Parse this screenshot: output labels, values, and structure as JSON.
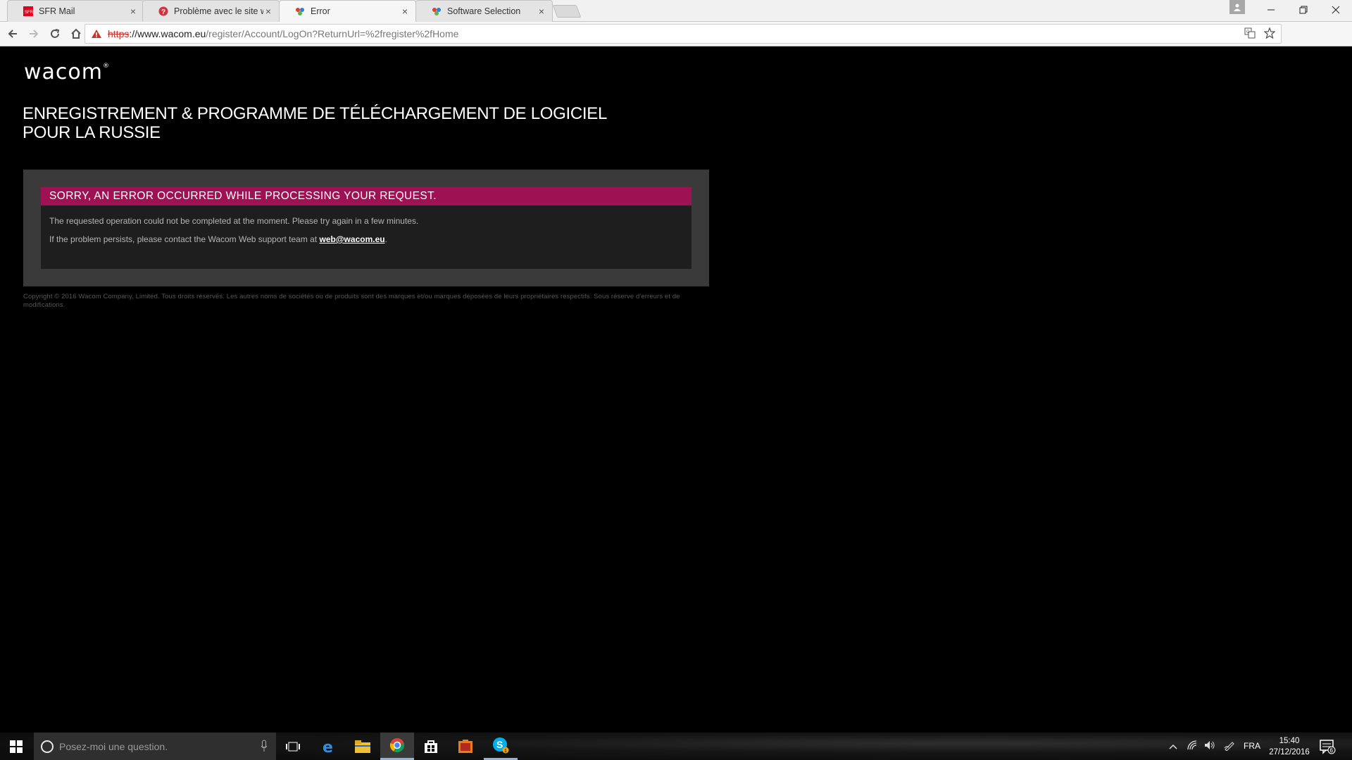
{
  "browser": {
    "tabs": [
      {
        "title": "SFR Mail",
        "icon": "sfr-mail-favicon",
        "active": false
      },
      {
        "title": "Problème avec le site wa",
        "icon": "question-favicon",
        "active": false
      },
      {
        "title": "Error",
        "icon": "wacom-favicon",
        "active": true
      },
      {
        "title": "Software Selection",
        "icon": "wacom-favicon",
        "active": false
      }
    ],
    "url": {
      "scheme": "https",
      "host": "://www.wacom.eu",
      "path": "/register/Account/LogOn?ReturnUrl=%2fregister%2fHome"
    }
  },
  "page": {
    "logo": "wacom",
    "title_line1": "ENREGISTREMENT & PROGRAMME DE TÉLÉCHARGEMENT DE LOGICIEL",
    "title_line2": "POUR LA RUSSIE",
    "error": {
      "heading": "SORRY, AN ERROR OCCURRED WHILE PROCESSING YOUR REQUEST.",
      "line1": "The requested operation could not be completed at the moment. Please try again in a few minutes.",
      "line2_prefix": "If the problem persists, please contact the Wacom Web support team at ",
      "email": "web@wacom.eu",
      "line2_suffix": "."
    },
    "copyright": "Copyright © 2016 Wacom Company, Limited. Tous droits réservés. Les autres noms de sociétés ou de produits sont des marques et/ou marques déposées de leurs propriétaires respectifs. Sous réserve d'erreurs et de modifications.",
    "colors": {
      "error_header": "#9e1254",
      "panel": "#3a3a3a",
      "inner": "#1e1e1e"
    }
  },
  "taskbar": {
    "search_placeholder": "Posez-moi une question.",
    "language": "FRA",
    "time": "15:40",
    "date": "27/12/2016",
    "notification_count": "6",
    "skype_badge": "1"
  }
}
